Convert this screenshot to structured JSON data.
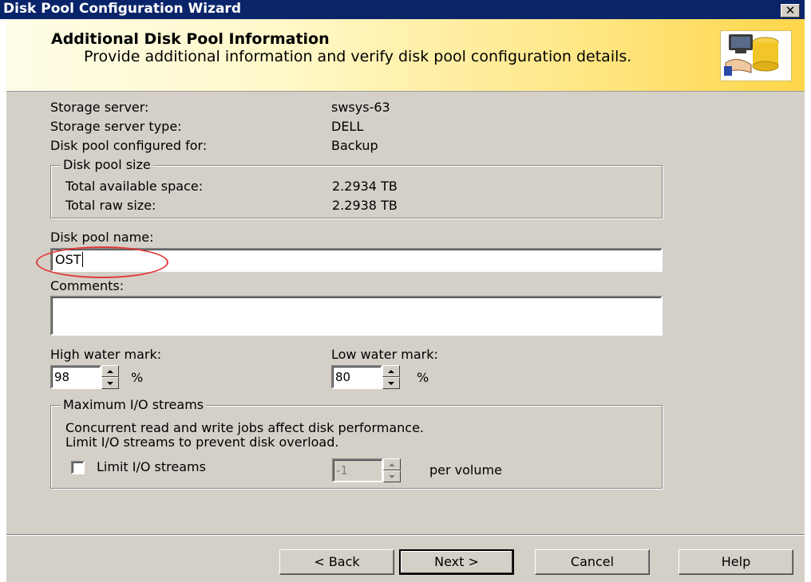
{
  "window": {
    "title": "Disk Pool Configuration Wizard",
    "close_glyph": "✕"
  },
  "header": {
    "title": "Additional Disk Pool Information",
    "subtitle": "Provide additional information and verify disk pool configuration details."
  },
  "info": {
    "storage_server_label": "Storage server:",
    "storage_server_value": "swsys-63",
    "storage_server_type_label": "Storage server type:",
    "storage_server_type_value": "DELL",
    "configured_for_label": "Disk pool configured for:",
    "configured_for_value": "Backup"
  },
  "pool_size": {
    "legend": "Disk pool size",
    "available_label": "Total available space:",
    "available_value": "2.2934 TB",
    "raw_label": "Total raw size:",
    "raw_value": "2.2938 TB"
  },
  "name": {
    "label": "Disk pool name:",
    "value": "OST"
  },
  "comments": {
    "label": "Comments:",
    "value": ""
  },
  "high_water": {
    "label": "High water mark:",
    "value": "98",
    "unit": "%"
  },
  "low_water": {
    "label": "Low water mark:",
    "value": "80",
    "unit": "%"
  },
  "io_streams": {
    "legend": "Maximum I/O streams",
    "description_line1": "Concurrent read and write jobs affect disk performance.",
    "description_line2": "Limit I/O streams to prevent disk overload.",
    "checkbox_label": "Limit I/O streams",
    "checkbox_checked": false,
    "value": "1",
    "suffix": "per volume"
  },
  "buttons": {
    "back": "< Back",
    "next": "Next >",
    "cancel": "Cancel",
    "help": "Help"
  },
  "icons": [
    "disk-pool-wizard-icon",
    "close-icon",
    "spin-up-icon",
    "spin-down-icon"
  ],
  "colors": {
    "title_bar": "#0a246a",
    "dialog_bg": "#d4d0c8",
    "annotation_circle": "#e03a3a"
  }
}
